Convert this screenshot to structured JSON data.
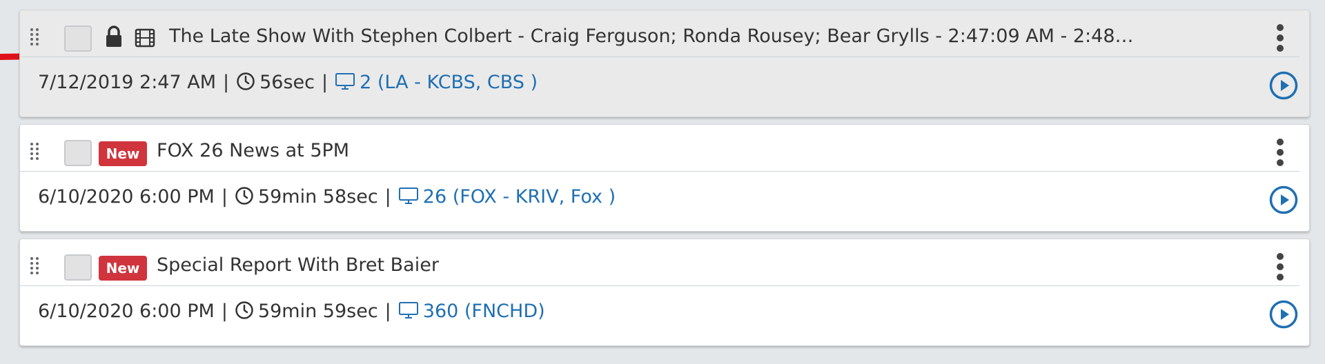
{
  "items": [
    {
      "title": "The Late Show With Stephen Colbert - Craig Ferguson; Ronda Rousey; Bear Grylls - 2:47:09 AM - 2:48:0...",
      "date": "7/12/2019 2:47 AM",
      "duration": "56sec",
      "channel": "2 (LA - KCBS, CBS )",
      "locked": true,
      "badge": ""
    },
    {
      "title": "FOX 26 News at 5PM",
      "date": "6/10/2020 6:00 PM",
      "duration": "59min 58sec",
      "channel": "26 (FOX - KRIV, Fox )",
      "locked": false,
      "badge": "New"
    },
    {
      "title": "Special Report With Bret Baier",
      "date": "6/10/2020 6:00 PM",
      "duration": "59min 59sec",
      "channel": "360 (FNCHD)",
      "locked": false,
      "badge": "New"
    }
  ],
  "separator": "|",
  "colors": {
    "accent": "#1f6fb2",
    "badge": "#d0343c",
    "marker": "#e0101a"
  },
  "icons": [
    "drag-grip-icon",
    "lock-icon",
    "film-icon",
    "kebab-menu-icon",
    "clock-icon",
    "monitor-icon",
    "play-circle-icon"
  ]
}
